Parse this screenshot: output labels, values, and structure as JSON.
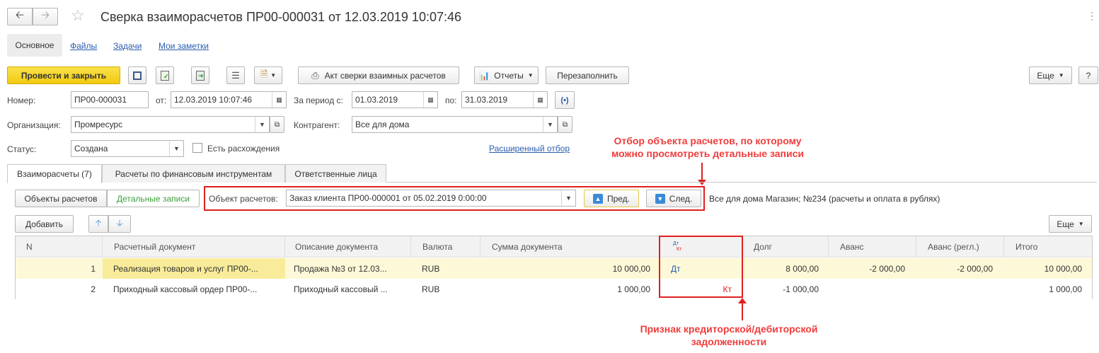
{
  "nav": {
    "back_icon": "arrow-left-icon",
    "forward_icon": "arrow-right-icon",
    "star_icon": "star-icon"
  },
  "window": {
    "title": "Сверка взаиморасчетов ПР00-000031 от 12.03.2019 10:07:46",
    "more_icon": "vertical-ellipsis-icon"
  },
  "sections": {
    "main": "Основное",
    "files": "Файлы",
    "tasks": "Задачи",
    "notes": "Мои заметки"
  },
  "toolbar": {
    "post_close": "Провести и закрыть",
    "act": "Акт сверки взаимных расчетов",
    "reports": "Отчеты",
    "refill": "Перезаполнить",
    "more": "Еще",
    "help": "?"
  },
  "form": {
    "number_label": "Номер:",
    "number": "ПР00-000031",
    "from_label": "от:",
    "date": "12.03.2019 10:07:46",
    "period_label": "За период с:",
    "period_from": "01.03.2019",
    "to_label": "по:",
    "period_to": "31.03.2019",
    "org_label": "Организация:",
    "org": "Промресурс",
    "contractor_label": "Контрагент:",
    "contractor": "Все для дома",
    "status_label": "Статус:",
    "status": "Создана",
    "discrepancy_label": "Есть расхождения",
    "advanced_filter": "Расширенный отбор"
  },
  "tabs": [
    "Взаиморасчеты (7)",
    "Расчеты по финансовым инструментам",
    "Ответственные лица"
  ],
  "subtabs": {
    "objects": "Объекты расчетов",
    "details": "Детальные записи"
  },
  "filter": {
    "object_label": "Объект расчетов:",
    "object": "Заказ клиента ПР00-000001 от 05.02.2019 0:00:00",
    "prev": "Пред.",
    "next": "След.",
    "info": "Все для дома Магазин; №234 (расчеты и оплата в рублях)"
  },
  "table_toolbar": {
    "add": "Добавить",
    "more": "Еще"
  },
  "table": {
    "columns": {
      "n": "N",
      "doc": "Расчетный документ",
      "desc": "Описание документа",
      "currency": "Валюта",
      "sum": "Сумма документа",
      "dk_top": "Дт",
      "dk_bottom": "Кт",
      "debt": "Долг",
      "advance": "Аванс",
      "advance_reg": "Аванс (регл.)",
      "total": "Итого"
    },
    "rows": [
      {
        "n": "1",
        "doc": "Реализация товаров и услуг ПР00-...",
        "desc": "Продажа №3 от 12.03...",
        "currency": "RUB",
        "sum": "10 000,00",
        "dt": "Дт",
        "kt": "",
        "debt": "8 000,00",
        "advance": "-2 000,00",
        "advance_reg": "-2 000,00",
        "total": "10 000,00"
      },
      {
        "n": "2",
        "doc": "Приходный кассовый ордер ПР00-...",
        "desc": "Приходный кассовый ...",
        "currency": "RUB",
        "sum": "1 000,00",
        "dt": "",
        "kt": "Кт",
        "debt": "-1 000,00",
        "advance": "",
        "advance_reg": "",
        "total": "1 000,00"
      }
    ]
  },
  "annotations": {
    "top_line1": "Отбор объекта расчетов, по которому",
    "top_line2": "можно просмотреть детальные записи",
    "bottom_line1": "Признак кредиторской/дебиторской",
    "bottom_line2": "задолженности"
  },
  "colors": {
    "accent_button": "#f5d016",
    "selected_row": "#fdf9d8",
    "annotation": "#f03c3c",
    "link": "#2a5db0"
  }
}
